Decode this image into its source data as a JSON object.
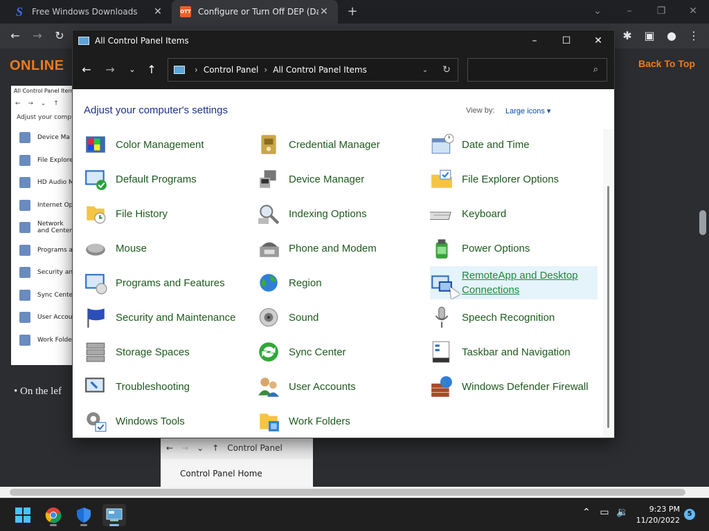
{
  "browser": {
    "tabs": [
      {
        "title": "Free Windows Downloads",
        "favicon": "S"
      },
      {
        "title": "Configure or Turn Off DEP (Data",
        "favicon": "OTT"
      }
    ],
    "new_tab": "+",
    "minimize": "–",
    "restore": "❐",
    "close": "✕"
  },
  "webpage": {
    "logo": "ONLINE",
    "back_to_top": "Back To Top",
    "shot_title": "All Control Panel Items",
    "shot_adjust": "Adjust your comp",
    "shot_items": [
      "Device Ma",
      "File Explore",
      "HD Audio M",
      "Internet Op",
      "Network and Center",
      "Programs a",
      "Security an",
      "Sync Cente",
      "User Accou",
      "Work Folde"
    ],
    "bullet": "• On the lef",
    "shot2_path": "Control Panel",
    "shot2_home": "Control Panel Home"
  },
  "window": {
    "title": "All Control Panel Items",
    "breadcrumb": [
      "Control Panel",
      "All Control Panel Items"
    ],
    "search_placeholder": "",
    "heading": "Adjust your computer's settings",
    "view_by_label": "View by:",
    "view_by_value": "Large icons ▾"
  },
  "items": [
    {
      "label": "Color Management",
      "icon": "color-management-icon",
      "col": 0,
      "row": 0
    },
    {
      "label": "Credential Manager",
      "icon": "credential-manager-icon",
      "col": 1,
      "row": 0
    },
    {
      "label": "Date and Time",
      "icon": "date-time-icon",
      "col": 2,
      "row": 0
    },
    {
      "label": "Default Programs",
      "icon": "default-programs-icon",
      "col": 0,
      "row": 1
    },
    {
      "label": "Device Manager",
      "icon": "device-manager-icon",
      "col": 1,
      "row": 1
    },
    {
      "label": "File Explorer Options",
      "icon": "file-explorer-options-icon",
      "col": 2,
      "row": 1
    },
    {
      "label": "File History",
      "icon": "file-history-icon",
      "col": 0,
      "row": 2
    },
    {
      "label": "Indexing Options",
      "icon": "indexing-options-icon",
      "col": 1,
      "row": 2
    },
    {
      "label": "Keyboard",
      "icon": "keyboard-icon",
      "col": 2,
      "row": 2
    },
    {
      "label": "Mouse",
      "icon": "mouse-icon",
      "col": 0,
      "row": 3
    },
    {
      "label": "Phone and Modem",
      "icon": "phone-modem-icon",
      "col": 1,
      "row": 3
    },
    {
      "label": "Power Options",
      "icon": "power-options-icon",
      "col": 2,
      "row": 3
    },
    {
      "label": "Programs and Features",
      "icon": "programs-features-icon",
      "col": 0,
      "row": 4
    },
    {
      "label": "Region",
      "icon": "region-icon",
      "col": 1,
      "row": 4
    },
    {
      "label": "RemoteApp and Desktop Connections",
      "icon": "remoteapp-icon",
      "col": 2,
      "row": 4,
      "hover": true
    },
    {
      "label": "Security and Maintenance",
      "icon": "security-maintenance-icon",
      "col": 0,
      "row": 5
    },
    {
      "label": "Sound",
      "icon": "sound-icon",
      "col": 1,
      "row": 5
    },
    {
      "label": "Speech Recognition",
      "icon": "speech-recognition-icon",
      "col": 2,
      "row": 5
    },
    {
      "label": "Storage Spaces",
      "icon": "storage-spaces-icon",
      "col": 0,
      "row": 6
    },
    {
      "label": "Sync Center",
      "icon": "sync-center-icon",
      "col": 1,
      "row": 6
    },
    {
      "label": "Taskbar and Navigation",
      "icon": "taskbar-navigation-icon",
      "col": 2,
      "row": 6
    },
    {
      "label": "Troubleshooting",
      "icon": "troubleshooting-icon",
      "col": 0,
      "row": 7
    },
    {
      "label": "User Accounts",
      "icon": "user-accounts-icon",
      "col": 1,
      "row": 7
    },
    {
      "label": "Windows Defender Firewall",
      "icon": "firewall-icon",
      "col": 2,
      "row": 7
    },
    {
      "label": "Windows Tools",
      "icon": "windows-tools-icon",
      "col": 0,
      "row": 8
    },
    {
      "label": "Work Folders",
      "icon": "work-folders-icon",
      "col": 1,
      "row": 8
    }
  ],
  "taskbar": {
    "time": "9:23 PM",
    "date": "11/20/2022",
    "notifications": "5"
  },
  "colors": {
    "link_green": "#1e5a1e",
    "heading_blue": "#1e3287",
    "accent_orange": "#f07c1d"
  }
}
